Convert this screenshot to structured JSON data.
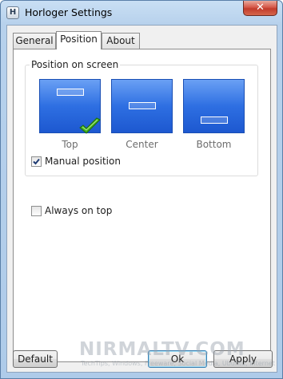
{
  "window": {
    "title": "Horloger Settings",
    "app_icon_letter": "H",
    "close_glyph": "✕"
  },
  "tabs": [
    {
      "label": "General",
      "active": false
    },
    {
      "label": "Position",
      "active": true
    },
    {
      "label": "About",
      "active": false
    }
  ],
  "position": {
    "group_label": "Position on screen",
    "options": [
      {
        "label": "Top",
        "selected": true
      },
      {
        "label": "Center",
        "selected": false
      },
      {
        "label": "Bottom",
        "selected": false
      }
    ],
    "manual_position": {
      "label": "Manual position",
      "checked": true
    }
  },
  "always_on_top": {
    "label": "Always on top",
    "checked": false
  },
  "buttons": {
    "default_label": "Default",
    "ok_label": "Ok",
    "apply_label": "Apply"
  },
  "watermark": {
    "text": "NIRMALTV.COM",
    "subtext": "TechTips, Windows, Freeware, Social Media, Ubuntu, Internet"
  },
  "colors": {
    "tile_blue": "#2e6fe2",
    "check_green": "#3fae1f",
    "close_red": "#c23b2c"
  }
}
